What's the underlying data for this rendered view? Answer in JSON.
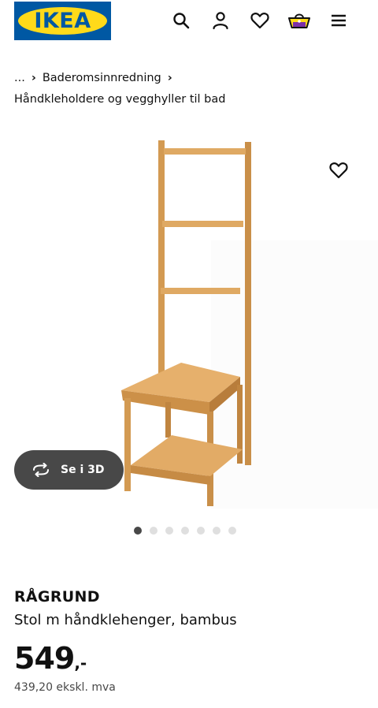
{
  "header": {
    "logo_text": "IKEA",
    "logo_reg": "®",
    "icons": [
      "search-icon",
      "user-icon",
      "heart-icon",
      "cart-icon",
      "menu-icon"
    ]
  },
  "breadcrumb": {
    "ellipsis": "...",
    "level1": "Baderomsinnredning",
    "level2": "Håndkleholdere og vegghyller til bad"
  },
  "viewer": {
    "button_3d_label": "Se i 3D",
    "image_count": 7,
    "active_index": 0
  },
  "product": {
    "name": "RÅGRUND",
    "description": "Stol m håndklehenger, bambus",
    "price_integer": "549",
    "price_suffix": ",-",
    "price_excl_vat": "439,20 ekskl. mva"
  },
  "colors": {
    "ikea_blue": "#0058a3",
    "ikea_yellow": "#ffda1a",
    "bamboo": "#d9a35c",
    "button_dark": "#484848"
  }
}
